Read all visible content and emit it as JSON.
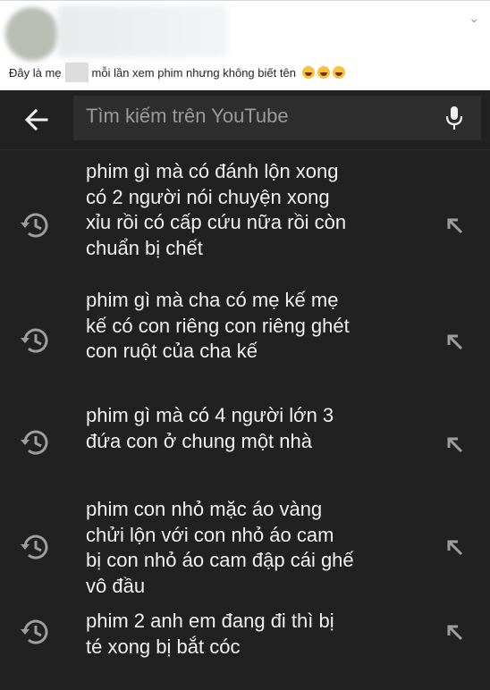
{
  "post": {
    "caption_before": "Đây là mẹ",
    "caption_after": "mỗi lần xem phim nhưng không biết tên",
    "emoji_count": 3
  },
  "search": {
    "placeholder": "Tìm kiếm trên YouTube"
  },
  "suggestions": [
    {
      "text": "phim gì mà có đánh lộn xong có 2 người nói chuyện xong xỉu rồi có cấp cứu nữa rồi còn chuẩn bị chết"
    },
    {
      "text": "phim gì mà cha có mẹ kế mẹ kế có con riêng con riêng ghét con ruột của cha kế"
    },
    {
      "text": "phim gì mà có 4 người lớn 3 đứa con ở chung một nhà"
    },
    {
      "text": "phim con nhỏ mặc áo vàng chửi lộn với con nhỏ áo cam bị con nhỏ áo cam đập cái ghế vô đầu"
    },
    {
      "text": "phim 2 anh em đang đi thì bị té xong bị bắt cóc"
    }
  ]
}
